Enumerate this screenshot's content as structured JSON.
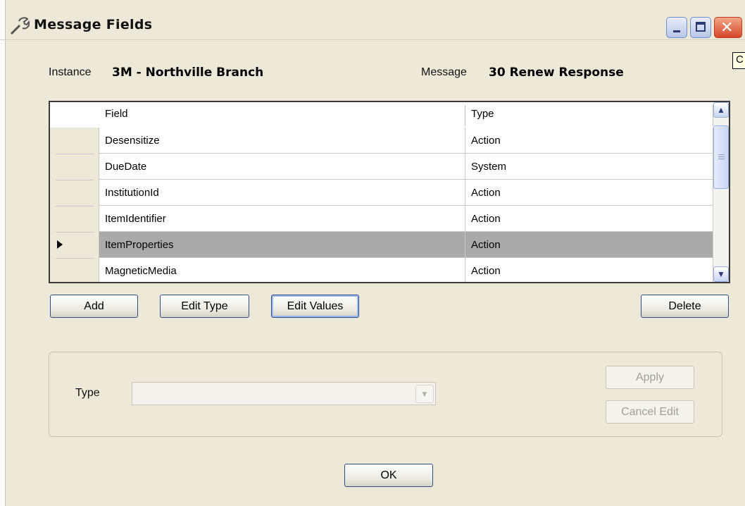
{
  "window": {
    "title": "Message Fields",
    "tooltip_fragment": "C"
  },
  "header": {
    "instance_label": "Instance",
    "instance_value": "3M - Northville Branch",
    "message_label": "Message",
    "message_value": "30 Renew Response"
  },
  "grid": {
    "columns": [
      "Field",
      "Type"
    ],
    "rows": [
      {
        "field": "Desensitize",
        "type": "Action",
        "selected": false
      },
      {
        "field": "DueDate",
        "type": "System",
        "selected": false
      },
      {
        "field": "InstitutionId",
        "type": "Action",
        "selected": false
      },
      {
        "field": "ItemIdentifier",
        "type": "Action",
        "selected": false
      },
      {
        "field": "ItemProperties",
        "type": "Action",
        "selected": true
      },
      {
        "field": "MagneticMedia",
        "type": "Action",
        "selected": false
      }
    ]
  },
  "buttons": {
    "add": "Add",
    "edit_type": "Edit Type",
    "edit_values": "Edit Values",
    "delete": "Delete"
  },
  "edit_panel": {
    "type_label": "Type",
    "type_value": "",
    "apply": "Apply",
    "cancel_edit": "Cancel Edit"
  },
  "footer": {
    "ok": "OK"
  }
}
